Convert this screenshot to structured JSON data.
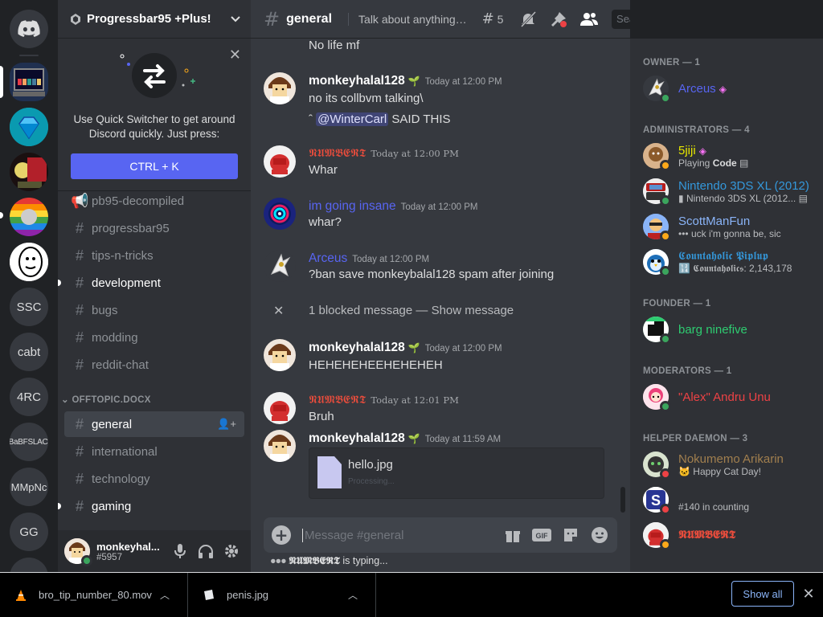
{
  "server": {
    "name": "Progressbar95 +Plus!",
    "rail_labels": [
      "SSC",
      "cabt",
      "4RC",
      "BaBFSLACi",
      "MMpNc",
      "GG"
    ]
  },
  "quick_switcher": {
    "text": "Use Quick Switcher to get around Discord quickly. Just press:",
    "shortcut": "CTRL + K"
  },
  "channels": [
    {
      "name": "pb95-decompiled",
      "icon": "megaphone"
    },
    {
      "name": "progressbar95",
      "icon": "hash"
    },
    {
      "name": "tips-n-tricks",
      "icon": "hash"
    },
    {
      "name": "development",
      "icon": "hash"
    },
    {
      "name": "bugs",
      "icon": "hash"
    },
    {
      "name": "modding",
      "icon": "hash"
    },
    {
      "name": "reddit-chat",
      "icon": "hash"
    }
  ],
  "category": "OFFTOPIC.DOCX",
  "offtopic_channels": [
    {
      "name": "general"
    },
    {
      "name": "international"
    },
    {
      "name": "technology"
    },
    {
      "name": "gaming"
    }
  ],
  "user": {
    "name": "monkeyhal...",
    "tag": "#5957"
  },
  "header": {
    "channel": "general",
    "topic": "Talk about anything th...",
    "threads_count": "5",
    "search_placeholder": "Search"
  },
  "messages": [
    {
      "content": "No life mf"
    },
    {
      "author": "monkeyhalal128",
      "time": "Today at 12:00 PM",
      "lines": [
        "no its collbvm talking\\"
      ],
      "mention_prefix": "ˆ",
      "mention": "@WinterCarl",
      "mention_suffix": "SAID THIS"
    },
    {
      "author": "𝕹𝖀𝕸𝕭𝕰𝕽𝕿",
      "time": "Today at 12:00 PM",
      "content": "Whar"
    },
    {
      "author": "im going insane",
      "time": "Today at 12:00 PM",
      "content": "whar?"
    },
    {
      "author": "Arceus",
      "time": "Today at 12:00 PM",
      "content": "?ban save monkeybalal128 spam after joining"
    },
    {
      "content": "1 blocked message — Show message"
    },
    {
      "author": "monkeyhalal128",
      "time": "Today at 12:00 PM",
      "content": "HEHEHEHEEHEHEHEH"
    },
    {
      "author": "𝕹𝖀𝕸𝕭𝕰𝕽𝕿",
      "time": "Today at 12:01 PM",
      "content": "Bruh"
    },
    {
      "author": "monkeyhalal128",
      "time": "Today at 11:59 AM"
    }
  ],
  "attachment": {
    "filename": "hello.jpg",
    "status": "Processing..."
  },
  "composer": {
    "placeholder": "Message #general"
  },
  "typing": {
    "user": "𝕹𝖀𝕸𝕭𝕰𝕽𝕿",
    "suffix": "is typing..."
  },
  "members": {
    "roles": [
      "OWNER — 1",
      "ADMINISTRATORS — 4",
      "FOUNDER — 1",
      "MODERATORS — 1",
      "HELPER DAEMON — 3"
    ],
    "list": [
      {
        "name": "Arceus",
        "activity": "",
        "color": "#5865f2",
        "status": "online"
      },
      {
        "name": "5jiji",
        "activity_prefix": "Playing",
        "activity": "Code",
        "color": "#e6e600",
        "status": "idle"
      },
      {
        "name": "Nintendo 3DS XL (2012)",
        "activity": "Nintendo 3DS XL (2012...",
        "color": "#3498db",
        "status": "online"
      },
      {
        "name": "ScottManFun",
        "activity": "uck i'm gonna be, sic",
        "color": "#8ab4f8",
        "status": "idle"
      },
      {
        "name": "𝕮𝖔𝖚𝖓𝖙𝖆𝖍𝖔𝖑𝖎𝖈 𝕻𝖎𝖕𝖑𝖚𝖕",
        "activity": "𝕮𝖔𝖚𝖓𝖙𝖆𝖍𝖔𝖑𝖎𝖈𝖘: 2,143,178",
        "color": "#3498db",
        "status": "online"
      },
      {
        "name": "barg ninefive",
        "activity": "",
        "color": "#2ecc71",
        "status": "online"
      },
      {
        "name": "\"Alex\" Andru Unu",
        "activity": "",
        "color": "#ed4245",
        "status": "online"
      },
      {
        "name": "Nokumemo Arikarin",
        "activity": "Happy Cat Day!",
        "color": "#a17f4e",
        "status": "dnd"
      },
      {
        "name": "",
        "activity": "#140 in counting",
        "color": "#5865f2",
        "status": "dnd"
      },
      {
        "name": "𝕹𝖀𝕸𝕭𝕰𝕽𝕿",
        "activity": "",
        "color": "#e74c3c",
        "status": "idle"
      }
    ]
  },
  "downloads": [
    {
      "name": "bro_tip_number_80.mov"
    },
    {
      "name": "penis.jpg"
    }
  ],
  "download_bar": {
    "show_all": "Show all"
  },
  "colors": {
    "blurple": "#5865f2",
    "online": "#3ba55d",
    "idle": "#faa81a",
    "dnd": "#ed4245",
    "red_name": "#e74c3c"
  }
}
